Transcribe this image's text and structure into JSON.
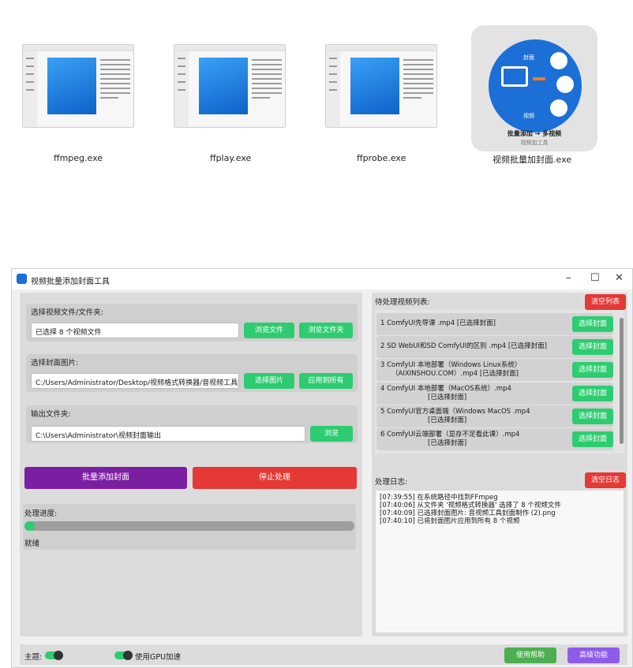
{
  "desktop": {
    "files": [
      {
        "name": "ffmpeg.exe"
      },
      {
        "name": "ffplay.exe"
      },
      {
        "name": "ffprobe.exe"
      },
      {
        "name": "视频批量加封面.exe"
      }
    ],
    "app_icon": {
      "label_cover": "封面",
      "label_video": "视频",
      "caption": "批量添加 → 多视频",
      "sub": "视频加工具"
    }
  },
  "window": {
    "title": "视频批量添加封面工具",
    "controls": {
      "minimize": "–",
      "maximize": "☐",
      "close": "✕"
    }
  },
  "left": {
    "video_label": "选择视频文件/文件夹:",
    "video_value": "已选择 8 个视频文件",
    "browse_file": "浏览文件",
    "browse_folder": "浏览文件夹",
    "cover_label": "选择封面图片:",
    "cover_value": "C:/Users/Administrator/Desktop/视频格式转换器/音视频工具封面制",
    "select_image": "选择图片",
    "apply_all": "应用到所有",
    "output_label": "输出文件夹:",
    "output_value": "C:\\Users\\Administrator\\视频封面输出",
    "browse": "浏览",
    "start_btn": "批量添加封面",
    "stop_btn": "停止处理",
    "progress_label": "处理进度:",
    "progress_fraction": 0.03,
    "status": "就绪"
  },
  "right": {
    "list_label": "待处理视频列表:",
    "clear_list": "清空列表",
    "select_cover": "选择封面",
    "videos": [
      {
        "line1": "1 ComfyUI先导课 .mp4 [已选择封面]",
        "line2": ""
      },
      {
        "line1": "2 SD WebUI和SD ComfyUI的区别 .mp4 [已选择封面]",
        "line2": ""
      },
      {
        "line1": "3 ComfyUI 本地部署（Windows Linux系统）",
        "line2": "（AIXINSHOU.COM）.mp4 [已选择封面]"
      },
      {
        "line1": "4 ComfyUI 本地部署（MacOS系统）.mp4",
        "line2": "[已选择封面]"
      },
      {
        "line1": "5 ComfyUI官方桌面端（Windows MacOS .mp4",
        "line2": "[已选择封面]"
      },
      {
        "line1": "6 ComfyUI云端部署（显存不足看此课）.mp4",
        "line2": "[已选择封面]"
      }
    ],
    "log_label": "处理日志:",
    "clear_log": "清空日志",
    "logs": [
      "[07:39:55] 在系统路径中找到FFmpeg",
      "[07:40:06] 从文件夹 '视频格式转换器' 选择了 8 个视频文件",
      "[07:40:09] 已选择封面图片: 音视频工具封面制作 (2).png",
      "[07:40:10] 已将封面图片应用到所有 8 个视频"
    ]
  },
  "footer": {
    "theme_label": "主题:",
    "gpu_label": "使用GPU加速",
    "help_btn": "使用帮助",
    "advanced_btn": "高级功能"
  },
  "colors": {
    "green": "#2ecc71",
    "red": "#e53935",
    "purple": "#7b1fa2",
    "violet": "#8e5ce8",
    "blue": "#1b6fd6"
  }
}
